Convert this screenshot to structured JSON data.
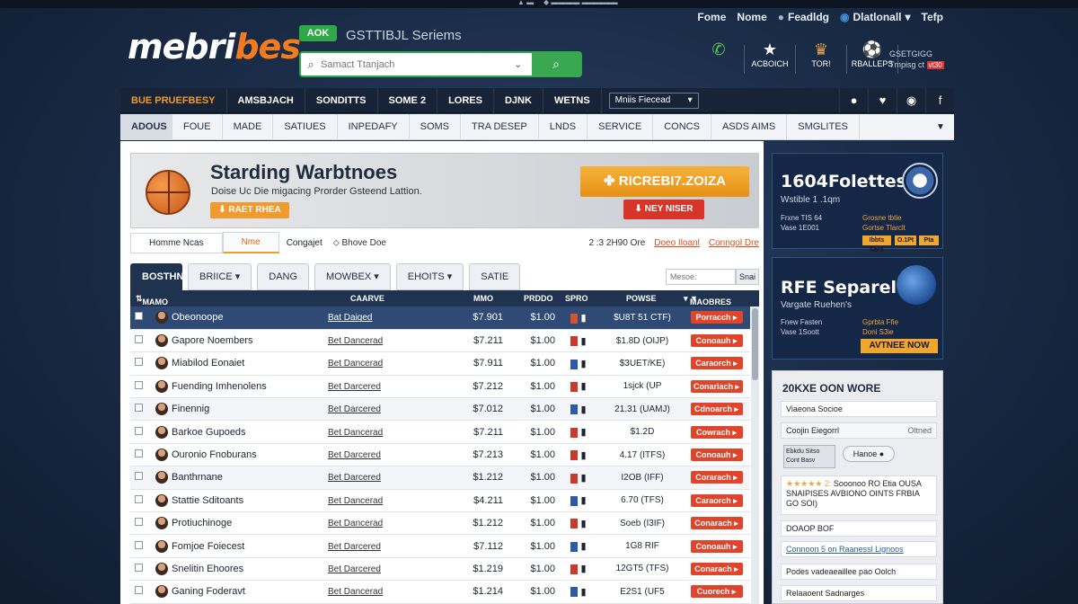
{
  "topbar": {
    "left_text": "▲ ▬",
    "right_text": "◆ ▬▬▬▬ ▬▬▬▬▬"
  },
  "util_nav": [
    {
      "label": "Fome",
      "icon": ""
    },
    {
      "label": "Nome",
      "icon": ""
    },
    {
      "label": "Feadldg",
      "icon": "person-icon"
    },
    {
      "label": "Dlatlonall",
      "icon": "globe-icon"
    },
    {
      "label": "Tefp",
      "icon": ""
    }
  ],
  "logo": {
    "main": "mebri",
    "accent": "bes"
  },
  "header": {
    "ok_label": "AOK",
    "tagline": "GSTTIBJL Seriems",
    "search_placeholder": "Samact Ttanjach",
    "search_icon": "search-icon",
    "icons": [
      {
        "label": "",
        "icon": "phone-icon",
        "glyph": "✆"
      },
      {
        "label": "ACBOICH",
        "icon": "star-icon",
        "glyph": "★"
      },
      {
        "label": "TOR!",
        "icon": "trophy-icon",
        "glyph": "♛"
      },
      {
        "label": "RBALLEPS",
        "icon": "ball-icon",
        "glyph": "⚽"
      }
    ],
    "side_line1": "GSETGIGG",
    "side_line2": "Tmpisg ct",
    "side_tag": "vt30"
  },
  "nav1": {
    "items": [
      "BUE PRUEFBESY",
      "AMSBJACH",
      "SONDITTS",
      "SOME 2",
      "LORES",
      "DJNK",
      "WETNS"
    ],
    "select_value": "Mniis Fiecead",
    "right_icons": [
      "apple-icon",
      "heart-icon",
      "user-icon",
      "facebook-icon"
    ],
    "right_glyphs": [
      "",
      "♥",
      "◉",
      "f"
    ]
  },
  "nav2": {
    "items": [
      "ADOUS",
      "FOUE",
      "MADE",
      "SATIUES",
      "INPEDAFY",
      "SOMS",
      "TRA DESEP",
      "LNDS",
      "SERVICE",
      "CONCS",
      "ASDS AIMS",
      "SMGLITES"
    ]
  },
  "banner": {
    "title": "Starding Warbtnoes",
    "subtitle": "Doise Uc Die migacing Prorder Gsteend Lattion.",
    "btn_left": "RAET RHEA",
    "btn_orange": "RICREBI7.ZOIZA",
    "btn_red": "NEY NISER"
  },
  "crumb": {
    "tab1": "Homme Ncas",
    "tab2": "Nme",
    "item3": "Congajet",
    "item4": "Bhove Doe",
    "meta": "2 :3 2H90 Ore",
    "link1": "Doeo Iloanl",
    "link2": "Conngol Dre"
  },
  "tabs": {
    "items": [
      "BOSTHNO",
      "BRIICE ▾",
      "DANG",
      "MOWBEX ▾",
      "EHOITS ▾",
      "SATIE"
    ],
    "filter_placeholder": "Mesoe:",
    "filter_btn": "Snai"
  },
  "table": {
    "headers": {
      "name": "MAMO",
      "col2": "CAARVE",
      "col3": "MMO",
      "col4": "PRDDO",
      "col5": "SPRO",
      "col6": "POWSE",
      "col7": "MAOBRES"
    },
    "rows": [
      {
        "name": "Obeonoope",
        "link": "Bat Daiged",
        "p1": "$7.901",
        "p2": "$1.00",
        "flag": "#d4552d",
        "odds": "$U8T 51 CTF)",
        "action": "Porracch"
      },
      {
        "name": "Gapore Noembers",
        "link": "Bet Dancerad",
        "p1": "$7.211",
        "p2": "$1.00",
        "flag": "#c93a2b",
        "odds": "$1.8D (OIJP)",
        "action": "Conoauh"
      },
      {
        "name": "Miabilod Eonaiet",
        "link": "Bet Dancerad",
        "p1": "$7.911",
        "p2": "$1.00",
        "flag": "#2c5aa8",
        "odds": "$3UET/KE)",
        "action": "Caraorch"
      },
      {
        "name": "Fuending Imhenolens",
        "link": "Bet Darcered",
        "p1": "$7.212",
        "p2": "$1.00",
        "flag": "#c93a2b",
        "odds": "1sjck (UP",
        "action": "Conariach"
      },
      {
        "name": "Finennig",
        "link": "Bet Darcered",
        "p1": "$7.012",
        "p2": "$1.00",
        "flag": "#2c5aa8",
        "odds": "21.31 (UAMJ)",
        "action": "Cdnoarch"
      },
      {
        "name": "Barkoe Gupoeds",
        "link": "Bet Dancerad",
        "p1": "$7.211",
        "p2": "$1.00",
        "flag": "#c93a2b",
        "odds": "$1.2D",
        "action": "Cowrach"
      },
      {
        "name": "Ouronio Fnoburans",
        "link": "Bet Darcered",
        "p1": "$7.213",
        "p2": "$1.00",
        "flag": "#c93a2b",
        "odds": "4.17 (ITFS)",
        "action": "Conoauh"
      },
      {
        "name": "Banthrnane",
        "link": "Bet Darcered",
        "p1": "$1.212",
        "p2": "$1.00",
        "flag": "#c93a2b",
        "odds": "I2OB (IFF)",
        "action": "Corarach"
      },
      {
        "name": "Stattie Sditoants",
        "link": "Bet Dancerad",
        "p1": "$4.211",
        "p2": "$1.00",
        "flag": "#2c5aa8",
        "odds": "6.70 (TFS)",
        "action": "Caraorch"
      },
      {
        "name": "Protiuchinoge",
        "link": "Bet Dancerad",
        "p1": "$1.212",
        "p2": "$1.00",
        "flag": "#c93a2b",
        "odds": "Soeb (I3IF)",
        "action": "Conarach"
      },
      {
        "name": "Fomjoe Foiecest",
        "link": "Bet Darcered",
        "p1": "$7.112",
        "p2": "$1.00",
        "flag": "#2c5aa8",
        "odds": "1G8 RIF",
        "action": "Conoauh"
      },
      {
        "name": "Snelitin Ehoores",
        "link": "Bet Darcered",
        "p1": "$1.219",
        "p2": "$1.00",
        "flag": "#c93a2b",
        "odds": "12GT5 (TFS)",
        "action": "Conarach"
      },
      {
        "name": "Ganing Foderavt",
        "link": "Bet Dancerad",
        "p1": "$1.214",
        "p2": "$1.00",
        "flag": "#2c5aa8",
        "odds": "E2S1 (UF5",
        "action": "Cuorech"
      }
    ]
  },
  "card1": {
    "title": "1604Folettes",
    "subtitle": "Wstible 1 .1qm",
    "l1": "Frxne TIS 64",
    "l2": "Vase 1E001",
    "r1": "Grosne tbtie",
    "r2": "Gortse Tlarclt",
    "b1": "Ibbts Sbra",
    "b2": "O.1Pt",
    "b3": "Pta"
  },
  "card2": {
    "title": "RFE Separel",
    "subtitle": "Vargate Ruehen's",
    "l1": "Fnew Fasten",
    "l2": "Vase 1Soott",
    "r1": "Gprbta Ffie",
    "r2": "Doni S3ie",
    "btn": "AVTNEE NOW"
  },
  "panel": {
    "title": "20KXE OON WORE",
    "r1": "Viaeona Socioe",
    "r2": "Coojin Eiegorrl",
    "r2_side": "Oltned",
    "r3a": "Ebkdu Sitso\nCont Basv",
    "r3b": "Hanoe",
    "stars": "★★★★★ 2:",
    "r4": "Sooonoo RO Etia OUSA SNAIPISES AVBIONO OINTS FRBIA GO SOI)",
    "r5": "DOAOP BOF",
    "r6": "Connoon 5 on Raanessl Lignoos",
    "r7": "Podes vadeaeaillee pao Oolch",
    "r8": "Relaaoent Sadnarges"
  },
  "colors": {
    "accent": "#f07c1f",
    "nav": "#172337",
    "green": "#2fa84a",
    "action": "#e0452b"
  }
}
